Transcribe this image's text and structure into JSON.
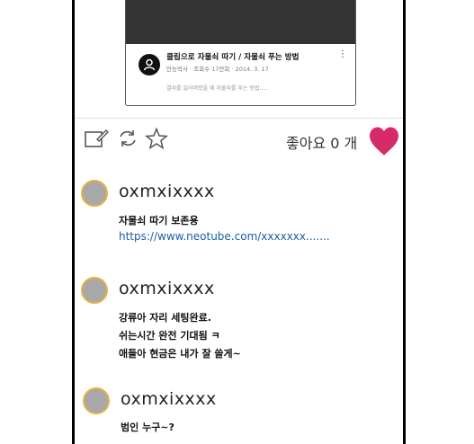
{
  "video": {
    "title": "클립으로 자물쇠 따기 / 자물쇠 푸는 방법",
    "meta": "만능박사 · 조회수 17만회 · 2014. 3. 17",
    "description": "열쇠를 잃어버렸을 때 자물쇠를 푸는 방법....."
  },
  "actions": {
    "like_label": "좋아요 0 개"
  },
  "comments": [
    {
      "username": "oxmxixxxx",
      "lines": [
        "자물쇠 따기 보존용"
      ],
      "link": "https://www.neotube.com/xxxxxxx......."
    },
    {
      "username": "oxmxixxxx",
      "lines": [
        "강류아 자리 세팅완료.",
        "쉬는시간 완전 기대됨 ㅋ",
        "애들아 현금은 내가 잘 쓸게~"
      ]
    },
    {
      "username": "oxmxixxxx",
      "lines": [
        "범인 누구~?"
      ]
    }
  ],
  "colors": {
    "heart": "#d62a6a",
    "avatar_ring": "#e8b240",
    "link": "#1a5fa8"
  }
}
